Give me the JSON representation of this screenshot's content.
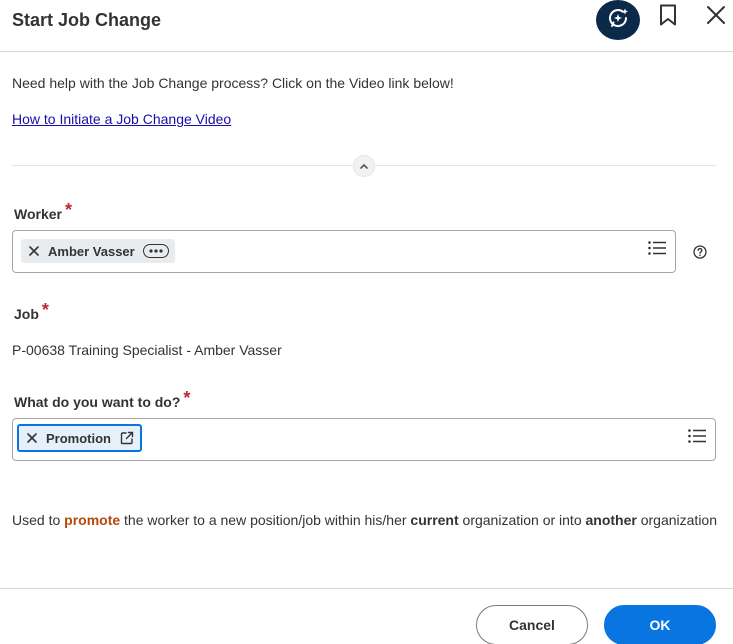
{
  "header": {
    "title": "Start Job Change"
  },
  "help": {
    "text": "Need help with the Job Change process? Click on the Video link below!",
    "video_link": "How to Initiate a Job Change Video"
  },
  "worker": {
    "label": "Worker",
    "required_mark": "*",
    "selected": "Amber Vasser"
  },
  "job": {
    "label": "Job",
    "required_mark": "*",
    "value": "P-00638 Training Specialist - Amber Vasser"
  },
  "action": {
    "label": "What do you want to do?",
    "required_mark": "*",
    "selected": "Promotion"
  },
  "description": {
    "part1": "Used to ",
    "promote": "promote",
    "part2": " the worker to a new position/job within his/her ",
    "current": "current",
    "part3": " organization or into ",
    "another": "another",
    "part4": " organization"
  },
  "footer": {
    "cancel_label": "Cancel",
    "ok_label": "OK"
  },
  "colors": {
    "primary": "#0875e1",
    "assist_bg": "#0b2a4a",
    "required": "#c0272d",
    "highlight_orange": "#b54a0a",
    "link": "#1a0dab"
  },
  "icons": [
    "assistant-sparkle-icon",
    "bookmark-icon",
    "close-icon",
    "chevron-up-icon",
    "chip-remove-icon",
    "more-options-icon",
    "list-prompt-icon",
    "help-circle-icon",
    "open-external-icon"
  ]
}
